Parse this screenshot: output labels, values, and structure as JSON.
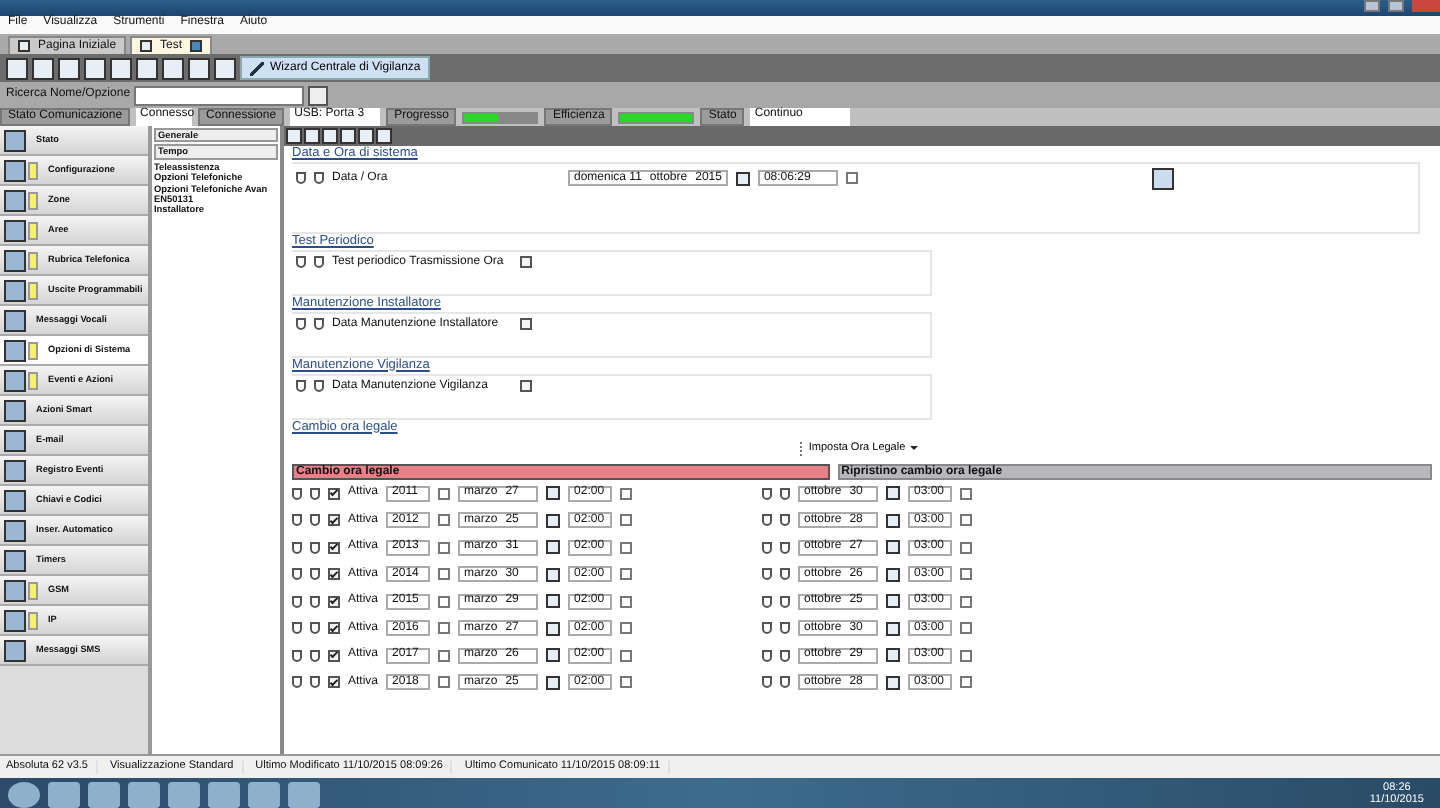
{
  "menu": [
    "File",
    "Visualizza",
    "Strumenti",
    "Finestra",
    "Aiuto"
  ],
  "tabs": [
    {
      "label": "Pagina Iniziale",
      "selected": false
    },
    {
      "label": "Test",
      "selected": true
    }
  ],
  "toolbar": {
    "wizard_button": "Wizard Centrale di Vigilanza"
  },
  "search": {
    "label": "Ricerca Nome/Opzione"
  },
  "status_row": {
    "comm_label": "Stato Comunicazione",
    "comm_value": "Connesso",
    "conn_label": "Connessione",
    "conn_value": "USB: Porta 3",
    "progress_label": "Progresso",
    "progress": {
      "level": 0.45
    },
    "efficiency_label": "Efficienza",
    "efficiency": {
      "level": 1
    },
    "state_label": "Stato",
    "state_value": "Continuo"
  },
  "sidebar": {
    "items": [
      {
        "label": "Stato",
        "flagged": false,
        "selected": false
      },
      {
        "label": "Configurazione",
        "flagged": true,
        "selected": false
      },
      {
        "label": "Zone",
        "flagged": true,
        "selected": false
      },
      {
        "label": "Aree",
        "flagged": true,
        "selected": false
      },
      {
        "label": "Rubrica Telefonica",
        "flagged": true,
        "selected": false
      },
      {
        "label": "Uscite Programmabili",
        "flagged": true,
        "selected": false
      },
      {
        "label": "Messaggi Vocali",
        "flagged": false,
        "selected": false
      },
      {
        "label": "Opzioni di Sistema",
        "flagged": true,
        "selected": true
      },
      {
        "label": "Eventi e Azioni",
        "flagged": true,
        "selected": false
      },
      {
        "label": "Azioni Smart",
        "flagged": false,
        "selected": false
      },
      {
        "label": "E-mail",
        "flagged": false,
        "selected": false
      },
      {
        "label": "Registro Eventi",
        "flagged": false,
        "selected": false
      },
      {
        "label": "Chiavi e Codici",
        "flagged": false,
        "selected": false
      },
      {
        "label": "Inser. Automatico",
        "flagged": false,
        "selected": false
      },
      {
        "label": "Timers",
        "flagged": false,
        "selected": false
      },
      {
        "label": "GSM",
        "flagged": true,
        "selected": false
      },
      {
        "label": "IP",
        "flagged": true,
        "selected": false
      },
      {
        "label": "Messaggi SMS",
        "flagged": false,
        "selected": false
      }
    ]
  },
  "tree": {
    "filters": [
      "Generale",
      "Tempo"
    ],
    "items": [
      "Teleassistenza",
      "Opzioni Telefoniche",
      "Opzioni Telefoniche Avan",
      "EN50131",
      "Installatore"
    ]
  },
  "sections": [
    {
      "title": "Data e Ora di sistema",
      "kind": "datetime",
      "label": "Data / Ora",
      "date_day": "domenica 11",
      "date_month": "ottobre",
      "date_year": "2015",
      "time": "08:06:29"
    },
    {
      "title": "Test Periodico",
      "kind": "checkbox",
      "label": "Test periodico Trasmissione Ora",
      "checked": false
    },
    {
      "title": "Manutenzione Installatore",
      "kind": "checkbox",
      "label": "Data Manutenzione Installatore",
      "checked": false
    },
    {
      "title": "Manutenzione Vigilanza",
      "kind": "checkbox",
      "label": "Data Manutenzione Vigilanza",
      "checked": false
    }
  ],
  "dst": {
    "title": "Cambio ora legale",
    "button": "Imposta Ora Legale",
    "left_header": "Cambio ora legale",
    "right_header": "Ripristino cambio ora legale",
    "rows": [
      {
        "checked": true,
        "active_label": "Attiva",
        "year": "2011",
        "start_month": "marzo",
        "start_day": "27",
        "start_time": "02:00",
        "end_month": "ottobre",
        "end_day": "30",
        "end_time": "03:00"
      },
      {
        "checked": true,
        "active_label": "Attiva",
        "year": "2012",
        "start_month": "marzo",
        "start_day": "25",
        "start_time": "02:00",
        "end_month": "ottobre",
        "end_day": "28",
        "end_time": "03:00"
      },
      {
        "checked": true,
        "active_label": "Attiva",
        "year": "2013",
        "start_month": "marzo",
        "start_day": "31",
        "start_time": "02:00",
        "end_month": "ottobre",
        "end_day": "27",
        "end_time": "03:00"
      },
      {
        "checked": true,
        "active_label": "Attiva",
        "year": "2014",
        "start_month": "marzo",
        "start_day": "30",
        "start_time": "02:00",
        "end_month": "ottobre",
        "end_day": "26",
        "end_time": "03:00"
      },
      {
        "checked": true,
        "active_label": "Attiva",
        "year": "2015",
        "start_month": "marzo",
        "start_day": "29",
        "start_time": "02:00",
        "end_month": "ottobre",
        "end_day": "25",
        "end_time": "03:00"
      },
      {
        "checked": true,
        "active_label": "Attiva",
        "year": "2016",
        "start_month": "marzo",
        "start_day": "27",
        "start_time": "02:00",
        "end_month": "ottobre",
        "end_day": "30",
        "end_time": "03:00"
      },
      {
        "checked": true,
        "active_label": "Attiva",
        "year": "2017",
        "start_month": "marzo",
        "start_day": "26",
        "start_time": "02:00",
        "end_month": "ottobre",
        "end_day": "29",
        "end_time": "03:00"
      },
      {
        "checked": true,
        "active_label": "Attiva",
        "year": "2018",
        "start_month": "marzo",
        "start_day": "25",
        "start_time": "02:00",
        "end_month": "ottobre",
        "end_day": "28",
        "end_time": "03:00"
      }
    ]
  },
  "status_bar": [
    "Absoluta 62 v3.5",
    "Visualizzazione Standard",
    "Ultimo Modificato 11/10/2015 08:09:26",
    "Ultimo Comunicato 11/10/2015 08:09:11"
  ],
  "taskbar": {
    "time": "08:26",
    "date": "11/10/2015"
  }
}
